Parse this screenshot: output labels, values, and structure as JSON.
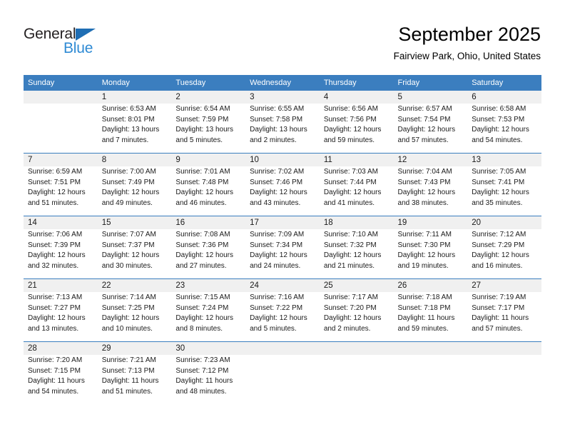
{
  "logo": {
    "text_primary": "General",
    "text_secondary": "Blue",
    "triangle_color": "#1f6eb4",
    "secondary_color": "#2e8ad4"
  },
  "header": {
    "month_title": "September 2025",
    "location": "Fairview Park, Ohio, United States",
    "header_bg_color": "#3b7ebf",
    "daynum_bg_color": "#f0f0f0"
  },
  "columns": [
    "Sunday",
    "Monday",
    "Tuesday",
    "Wednesday",
    "Thursday",
    "Friday",
    "Saturday"
  ],
  "weeks": [
    [
      {
        "day": "",
        "lines": []
      },
      {
        "day": "1",
        "lines": [
          "Sunrise: 6:53 AM",
          "Sunset: 8:01 PM",
          "Daylight: 13 hours",
          "and 7 minutes."
        ]
      },
      {
        "day": "2",
        "lines": [
          "Sunrise: 6:54 AM",
          "Sunset: 7:59 PM",
          "Daylight: 13 hours",
          "and 5 minutes."
        ]
      },
      {
        "day": "3",
        "lines": [
          "Sunrise: 6:55 AM",
          "Sunset: 7:58 PM",
          "Daylight: 13 hours",
          "and 2 minutes."
        ]
      },
      {
        "day": "4",
        "lines": [
          "Sunrise: 6:56 AM",
          "Sunset: 7:56 PM",
          "Daylight: 12 hours",
          "and 59 minutes."
        ]
      },
      {
        "day": "5",
        "lines": [
          "Sunrise: 6:57 AM",
          "Sunset: 7:54 PM",
          "Daylight: 12 hours",
          "and 57 minutes."
        ]
      },
      {
        "day": "6",
        "lines": [
          "Sunrise: 6:58 AM",
          "Sunset: 7:53 PM",
          "Daylight: 12 hours",
          "and 54 minutes."
        ]
      }
    ],
    [
      {
        "day": "7",
        "lines": [
          "Sunrise: 6:59 AM",
          "Sunset: 7:51 PM",
          "Daylight: 12 hours",
          "and 51 minutes."
        ]
      },
      {
        "day": "8",
        "lines": [
          "Sunrise: 7:00 AM",
          "Sunset: 7:49 PM",
          "Daylight: 12 hours",
          "and 49 minutes."
        ]
      },
      {
        "day": "9",
        "lines": [
          "Sunrise: 7:01 AM",
          "Sunset: 7:48 PM",
          "Daylight: 12 hours",
          "and 46 minutes."
        ]
      },
      {
        "day": "10",
        "lines": [
          "Sunrise: 7:02 AM",
          "Sunset: 7:46 PM",
          "Daylight: 12 hours",
          "and 43 minutes."
        ]
      },
      {
        "day": "11",
        "lines": [
          "Sunrise: 7:03 AM",
          "Sunset: 7:44 PM",
          "Daylight: 12 hours",
          "and 41 minutes."
        ]
      },
      {
        "day": "12",
        "lines": [
          "Sunrise: 7:04 AM",
          "Sunset: 7:43 PM",
          "Daylight: 12 hours",
          "and 38 minutes."
        ]
      },
      {
        "day": "13",
        "lines": [
          "Sunrise: 7:05 AM",
          "Sunset: 7:41 PM",
          "Daylight: 12 hours",
          "and 35 minutes."
        ]
      }
    ],
    [
      {
        "day": "14",
        "lines": [
          "Sunrise: 7:06 AM",
          "Sunset: 7:39 PM",
          "Daylight: 12 hours",
          "and 32 minutes."
        ]
      },
      {
        "day": "15",
        "lines": [
          "Sunrise: 7:07 AM",
          "Sunset: 7:37 PM",
          "Daylight: 12 hours",
          "and 30 minutes."
        ]
      },
      {
        "day": "16",
        "lines": [
          "Sunrise: 7:08 AM",
          "Sunset: 7:36 PM",
          "Daylight: 12 hours",
          "and 27 minutes."
        ]
      },
      {
        "day": "17",
        "lines": [
          "Sunrise: 7:09 AM",
          "Sunset: 7:34 PM",
          "Daylight: 12 hours",
          "and 24 minutes."
        ]
      },
      {
        "day": "18",
        "lines": [
          "Sunrise: 7:10 AM",
          "Sunset: 7:32 PM",
          "Daylight: 12 hours",
          "and 21 minutes."
        ]
      },
      {
        "day": "19",
        "lines": [
          "Sunrise: 7:11 AM",
          "Sunset: 7:30 PM",
          "Daylight: 12 hours",
          "and 19 minutes."
        ]
      },
      {
        "day": "20",
        "lines": [
          "Sunrise: 7:12 AM",
          "Sunset: 7:29 PM",
          "Daylight: 12 hours",
          "and 16 minutes."
        ]
      }
    ],
    [
      {
        "day": "21",
        "lines": [
          "Sunrise: 7:13 AM",
          "Sunset: 7:27 PM",
          "Daylight: 12 hours",
          "and 13 minutes."
        ]
      },
      {
        "day": "22",
        "lines": [
          "Sunrise: 7:14 AM",
          "Sunset: 7:25 PM",
          "Daylight: 12 hours",
          "and 10 minutes."
        ]
      },
      {
        "day": "23",
        "lines": [
          "Sunrise: 7:15 AM",
          "Sunset: 7:24 PM",
          "Daylight: 12 hours",
          "and 8 minutes."
        ]
      },
      {
        "day": "24",
        "lines": [
          "Sunrise: 7:16 AM",
          "Sunset: 7:22 PM",
          "Daylight: 12 hours",
          "and 5 minutes."
        ]
      },
      {
        "day": "25",
        "lines": [
          "Sunrise: 7:17 AM",
          "Sunset: 7:20 PM",
          "Daylight: 12 hours",
          "and 2 minutes."
        ]
      },
      {
        "day": "26",
        "lines": [
          "Sunrise: 7:18 AM",
          "Sunset: 7:18 PM",
          "Daylight: 11 hours",
          "and 59 minutes."
        ]
      },
      {
        "day": "27",
        "lines": [
          "Sunrise: 7:19 AM",
          "Sunset: 7:17 PM",
          "Daylight: 11 hours",
          "and 57 minutes."
        ]
      }
    ],
    [
      {
        "day": "28",
        "lines": [
          "Sunrise: 7:20 AM",
          "Sunset: 7:15 PM",
          "Daylight: 11 hours",
          "and 54 minutes."
        ]
      },
      {
        "day": "29",
        "lines": [
          "Sunrise: 7:21 AM",
          "Sunset: 7:13 PM",
          "Daylight: 11 hours",
          "and 51 minutes."
        ]
      },
      {
        "day": "30",
        "lines": [
          "Sunrise: 7:23 AM",
          "Sunset: 7:12 PM",
          "Daylight: 11 hours",
          "and 48 minutes."
        ]
      },
      {
        "day": "",
        "lines": []
      },
      {
        "day": "",
        "lines": []
      },
      {
        "day": "",
        "lines": []
      },
      {
        "day": "",
        "lines": []
      }
    ]
  ]
}
